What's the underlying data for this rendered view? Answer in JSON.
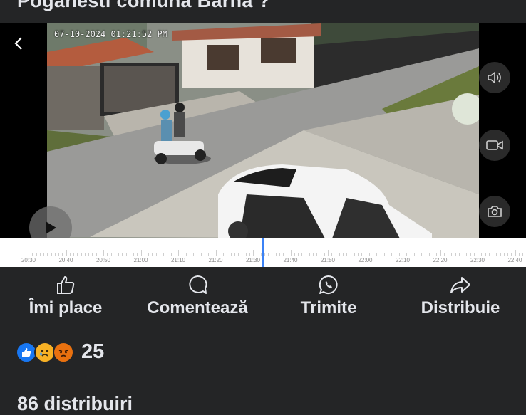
{
  "post": {
    "title": "Poganesti comuna Barna ?"
  },
  "video": {
    "timestamp": "07-10-2024 01:21:52 PM",
    "icons": {
      "back": "chevron-left-icon",
      "play": "play-icon",
      "volume": "volume-icon",
      "record": "video-camera-icon",
      "snapshot": "camera-icon"
    }
  },
  "timeline": {
    "labels": [
      "20:30",
      "20:40",
      "20:50",
      "21:00",
      "21:10",
      "21:20",
      "21:30",
      "21:40",
      "21:50",
      "22:00",
      "22:10",
      "22:20",
      "22:30",
      "22:40"
    ],
    "current": "21:33"
  },
  "actions": [
    {
      "label": "Îmi place",
      "icon": "thumbs-up-icon"
    },
    {
      "label": "Comentează",
      "icon": "comment-icon"
    },
    {
      "label": "Trimite",
      "icon": "whatsapp-icon"
    },
    {
      "label": "Distribuie",
      "icon": "share-icon"
    }
  ],
  "reactions": {
    "types": [
      "like",
      "sad",
      "angry"
    ],
    "count": "25",
    "colors": {
      "like": "#1877f2",
      "sad": "#f7b125",
      "angry": "#e9710f"
    }
  },
  "shares": {
    "label": "86 distribuiri"
  }
}
